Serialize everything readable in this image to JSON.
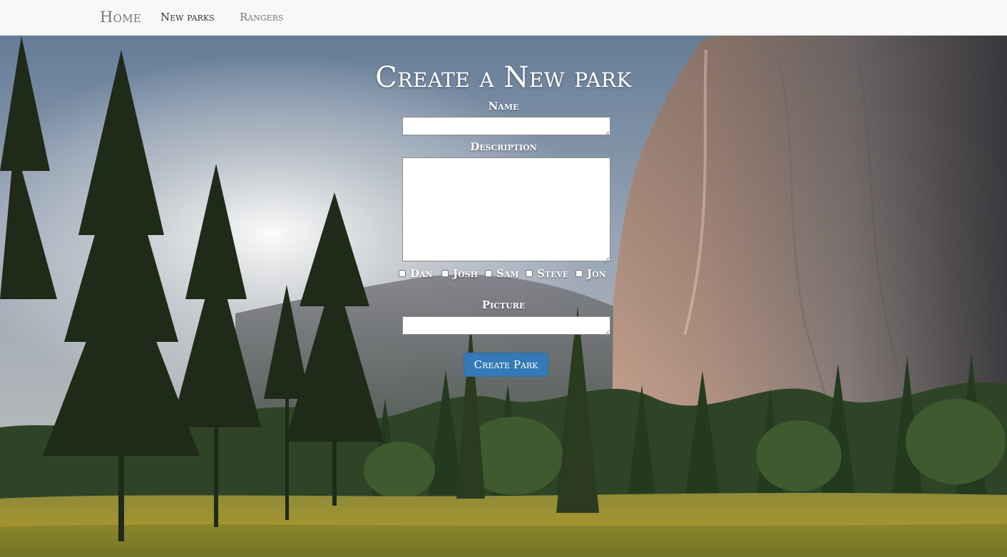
{
  "nav": {
    "brand": "Home",
    "links": [
      {
        "label": "New parks",
        "active": true
      },
      {
        "label": "Rangers",
        "active": false
      }
    ]
  },
  "form": {
    "title": "Create a New park",
    "name_label": "Name",
    "name_value": "",
    "description_label": "Description",
    "description_value": "",
    "rangers": [
      {
        "label": "Dan",
        "checked": false
      },
      {
        "label": "Josh",
        "checked": false
      },
      {
        "label": "Sam",
        "checked": false
      },
      {
        "label": "Steve",
        "checked": false
      },
      {
        "label": "Jon",
        "checked": false
      }
    ],
    "picture_label": "Picture",
    "picture_value": "",
    "submit_label": "Create Park"
  },
  "colors": {
    "navbar_bg": "#f8f8f8",
    "nav_text": "#777777",
    "button_bg": "#337ab7",
    "title_text": "#ffffff"
  }
}
